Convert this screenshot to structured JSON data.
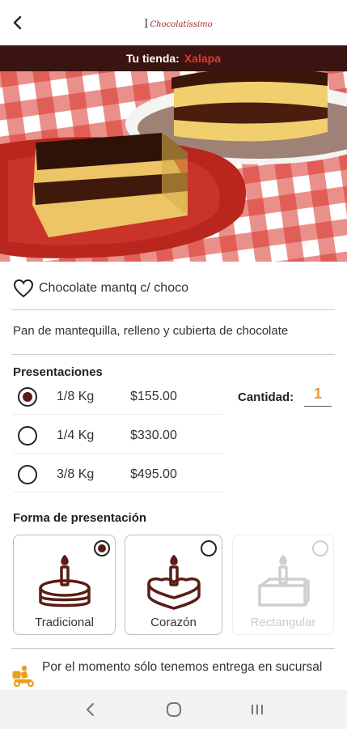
{
  "header": {
    "back_icon": "chevron-left-icon",
    "logo": {
      "prefix": "I",
      "word": "Chocolatíssimo"
    }
  },
  "store": {
    "label": "Tu tienda:",
    "name": "Xalapa",
    "accent": "#e23a2a",
    "bar_color": "#3a1410"
  },
  "product": {
    "name": "Chocolate mantq c/ choco",
    "description": "Pan de mantequilla, relleno y cubierta de chocolate",
    "favorite_icon": "heart-outline-icon"
  },
  "presentaciones": {
    "title": "Presentaciones",
    "options": [
      {
        "weight": "1/8 Kg",
        "price": "$155.00",
        "selected": true
      },
      {
        "weight": "1/4 Kg",
        "price": "$330.00",
        "selected": false
      },
      {
        "weight": "3/8 Kg",
        "price": "$495.00",
        "selected": false
      }
    ]
  },
  "cantidad": {
    "label": "Cantidad:",
    "value": "1"
  },
  "forma": {
    "title": "Forma de presentación",
    "shapes": [
      {
        "label": "Tradicional",
        "selected": true,
        "enabled": true,
        "icon": "round-cake-icon"
      },
      {
        "label": "Corazón",
        "selected": false,
        "enabled": true,
        "icon": "heart-cake-icon"
      },
      {
        "label": "Rectangular",
        "selected": false,
        "enabled": false,
        "icon": "rectangular-cake-icon"
      }
    ]
  },
  "delivery": {
    "text": "Por el momento sólo tenemos entrega en sucursal",
    "icon": "delivery-scooter-icon"
  },
  "system_nav": {
    "back": "nav-back-icon",
    "home": "nav-home-icon",
    "recents": "nav-recents-icon"
  },
  "colors": {
    "brand_brown": "#5a1d14",
    "accent_orange": "#e8a020"
  }
}
